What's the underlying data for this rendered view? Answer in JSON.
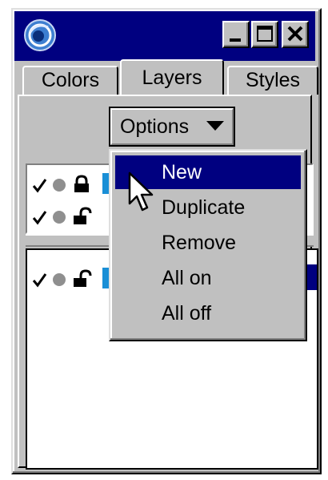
{
  "window": {
    "icon": "swirl-app-icon",
    "controls": [
      "minimize-icon",
      "maximize-icon",
      "close-icon"
    ]
  },
  "tabs": [
    {
      "label": "Colors",
      "active": false
    },
    {
      "label": "Layers",
      "active": true
    },
    {
      "label": "Styles",
      "active": false
    }
  ],
  "options_button": {
    "label": "Options",
    "icon": "dropdown-arrow-icon"
  },
  "menu": {
    "items": [
      {
        "label": "New",
        "selected": true
      },
      {
        "label": "Duplicate",
        "selected": false
      },
      {
        "label": "Remove",
        "selected": false
      },
      {
        "label": "All on",
        "selected": false
      },
      {
        "label": "All off",
        "selected": false
      }
    ]
  },
  "layers": {
    "upper": [
      {
        "visible": true,
        "lock": "locked",
        "color": "#1a8fd6"
      },
      {
        "visible": true,
        "lock": "unlocked"
      }
    ],
    "lower": [
      {
        "visible": true,
        "lock": "unlocked",
        "color": "#1a8fd6",
        "selected": true
      }
    ]
  },
  "colors": {
    "titlebar": "#000080",
    "face": "#c0c0c0",
    "highlight": "#000080",
    "layer_swatch": "#1a8fd6"
  },
  "cursor": "arrow-pointer-icon"
}
